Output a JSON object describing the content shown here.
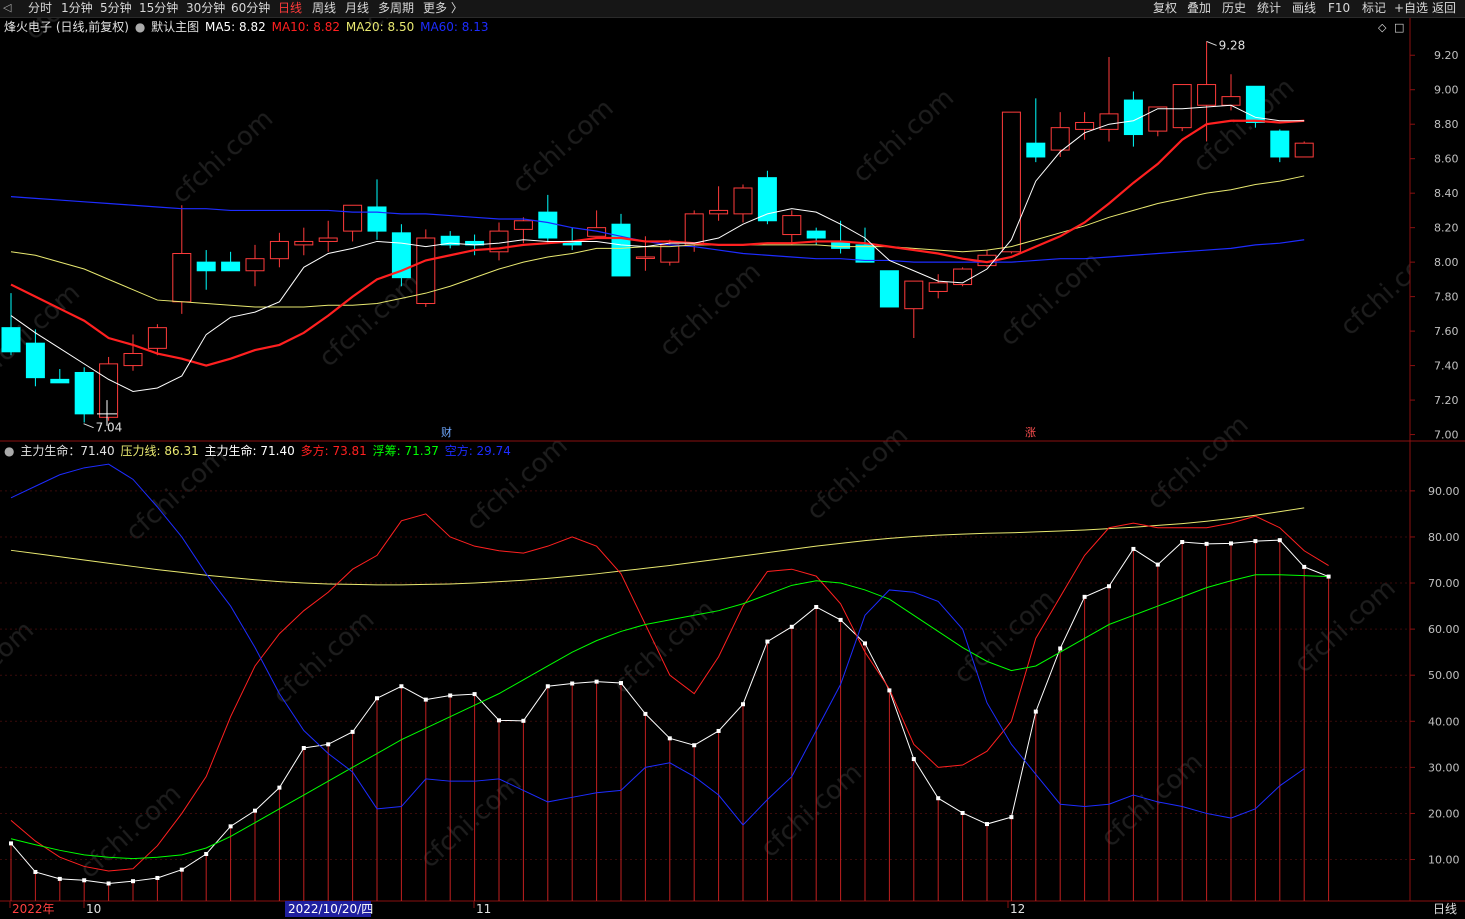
{
  "topbar": {
    "periods": [
      "分时",
      "1分钟",
      "5分钟",
      "15分钟",
      "30分钟",
      "60分钟",
      "日线",
      "周线",
      "月线",
      "多周期",
      "更多 〉"
    ],
    "active_period": "日线",
    "tools": [
      "复权",
      "叠加",
      "历史",
      "统计",
      "画线",
      "F10",
      "标记",
      "+自选",
      "返回"
    ]
  },
  "main_legend": {
    "stock": "烽火电子 (日线,前复权)",
    "indicator_name": "默认主图",
    "ma5": "MA5: 8.82",
    "ma10": "MA10: 8.82",
    "ma20": "MA20: 8.50",
    "ma60": "MA60: 8.13"
  },
  "sub_legend": {
    "title": "主力生命：71.40",
    "pressure": "压力线: 86.31",
    "life": "主力生命: 71.40",
    "long": "多方: 73.81",
    "float": "浮筹: 71.37",
    "short": "空方: 29.74"
  },
  "annotations": {
    "high": "9.28",
    "low": "7.04",
    "cai": "财",
    "zhang": "涨"
  },
  "time_axis": {
    "year": "2022年",
    "oct": "10",
    "cursor_date": "2022/10/20/四",
    "nov": "11",
    "dec": "12"
  },
  "bottom_period": "日线",
  "colors": {
    "up": "#ff3b3b",
    "down": "#00ffff",
    "ma5": "#ffffff",
    "ma10": "#ff2020",
    "ma20": "#e8e870",
    "ma60": "#1d2cff",
    "long": "#ff2020",
    "float": "#00ff00",
    "short": "#1d2cff",
    "pressure": "#e8e870"
  },
  "chart_data": [
    {
      "type": "candlestick",
      "title": "烽火电子 (日线,前复权)",
      "y_ticks": [
        "9.20",
        "9.00",
        "8.80",
        "8.60",
        "8.40",
        "8.20",
        "8.00",
        "7.80",
        "7.60",
        "7.40",
        "7.20",
        "7.00"
      ],
      "ylim": [
        6.98,
        9.3
      ],
      "ohlc": [
        [
          7.62,
          7.82,
          7.46,
          7.48
        ],
        [
          7.53,
          7.61,
          7.28,
          7.33
        ],
        [
          7.32,
          7.38,
          7.3,
          7.3
        ],
        [
          7.36,
          7.39,
          7.07,
          7.12
        ],
        [
          7.1,
          7.45,
          7.08,
          7.41
        ],
        [
          7.4,
          7.58,
          7.37,
          7.47
        ],
        [
          7.5,
          7.64,
          7.46,
          7.62
        ],
        [
          7.77,
          8.33,
          7.7,
          8.05
        ],
        [
          8.0,
          8.07,
          7.84,
          7.95
        ],
        [
          8.0,
          8.06,
          7.95,
          7.95
        ],
        [
          7.95,
          8.1,
          7.86,
          8.02
        ],
        [
          8.02,
          8.17,
          7.97,
          8.12
        ],
        [
          8.1,
          8.2,
          8.04,
          8.12
        ],
        [
          8.12,
          8.24,
          8.06,
          8.14
        ],
        [
          8.18,
          8.33,
          8.12,
          8.33
        ],
        [
          8.32,
          8.48,
          8.13,
          8.18
        ],
        [
          8.17,
          8.22,
          7.86,
          7.91
        ],
        [
          7.76,
          8.19,
          7.74,
          8.14
        ],
        [
          8.15,
          8.18,
          8.08,
          8.1
        ],
        [
          8.12,
          8.16,
          8.04,
          8.1
        ],
        [
          8.06,
          8.23,
          8.01,
          8.18
        ],
        [
          8.19,
          8.26,
          8.11,
          8.24
        ],
        [
          8.29,
          8.39,
          8.11,
          8.14
        ],
        [
          8.12,
          8.2,
          8.07,
          8.1
        ],
        [
          8.15,
          8.3,
          8.15,
          8.2
        ],
        [
          8.22,
          8.28,
          8.1,
          7.92
        ],
        [
          8.03,
          8.15,
          7.95,
          8.03
        ],
        [
          8.0,
          8.13,
          7.98,
          8.1
        ],
        [
          8.1,
          8.3,
          8.06,
          8.28
        ],
        [
          8.28,
          8.44,
          8.24,
          8.3
        ],
        [
          8.28,
          8.45,
          8.23,
          8.43
        ],
        [
          8.49,
          8.53,
          8.22,
          8.24
        ],
        [
          8.16,
          8.3,
          8.1,
          8.27
        ],
        [
          8.18,
          8.2,
          8.1,
          8.14
        ],
        [
          8.12,
          8.24,
          8.05,
          8.08
        ],
        [
          8.1,
          8.2,
          8.0,
          8.0
        ],
        [
          7.95,
          7.95,
          7.74,
          7.74
        ],
        [
          7.73,
          7.89,
          7.56,
          7.89
        ],
        [
          7.83,
          7.93,
          7.79,
          7.88
        ],
        [
          7.87,
          7.97,
          7.86,
          7.96
        ],
        [
          7.98,
          8.07,
          7.97,
          8.04
        ],
        [
          8.06,
          8.87,
          8.05,
          8.87
        ],
        [
          8.69,
          8.95,
          8.58,
          8.61
        ],
        [
          8.65,
          8.87,
          8.61,
          8.78
        ],
        [
          8.77,
          8.87,
          8.71,
          8.81
        ],
        [
          8.77,
          9.19,
          8.7,
          8.86
        ],
        [
          8.94,
          8.99,
          8.67,
          8.74
        ],
        [
          8.76,
          8.9,
          8.73,
          8.9
        ],
        [
          8.78,
          9.03,
          8.76,
          9.03
        ],
        [
          8.91,
          9.28,
          8.7,
          9.03
        ],
        [
          8.91,
          9.09,
          8.88,
          8.96
        ],
        [
          9.02,
          9.02,
          8.78,
          8.81
        ],
        [
          8.76,
          8.77,
          8.58,
          8.61
        ],
        [
          8.61,
          8.7,
          8.61,
          8.69
        ]
      ],
      "ma5": [
        7.69,
        7.59,
        7.5,
        7.41,
        7.32,
        7.25,
        7.27,
        7.34,
        7.58,
        7.68,
        7.71,
        7.77,
        7.97,
        8.05,
        8.08,
        8.12,
        8.11,
        8.09,
        8.11,
        8.1,
        8.11,
        8.13,
        8.12,
        8.12,
        8.12,
        8.1,
        8.09,
        8.11,
        8.11,
        8.14,
        8.22,
        8.28,
        8.31,
        8.29,
        8.22,
        8.14,
        8.01,
        7.95,
        7.89,
        7.88,
        7.96,
        8.13,
        8.47,
        8.64,
        8.75,
        8.8,
        8.82,
        8.89,
        8.89,
        8.9,
        8.91,
        8.84,
        8.82,
        8.82
      ],
      "ma10": [
        7.87,
        7.8,
        7.73,
        7.66,
        7.56,
        7.52,
        7.47,
        7.44,
        7.4,
        7.44,
        7.49,
        7.52,
        7.59,
        7.69,
        7.8,
        7.9,
        7.95,
        8.01,
        8.04,
        8.07,
        8.08,
        8.1,
        8.11,
        8.12,
        8.14,
        8.14,
        8.12,
        8.12,
        8.11,
        8.1,
        8.1,
        8.11,
        8.11,
        8.12,
        8.12,
        8.11,
        8.09,
        8.07,
        8.05,
        8.02,
        8.0,
        8.03,
        8.09,
        8.15,
        8.23,
        8.34,
        8.46,
        8.57,
        8.71,
        8.8,
        8.82,
        8.82,
        8.81,
        8.82
      ],
      "ma20": [
        8.06,
        8.04,
        8.0,
        7.96,
        7.9,
        7.84,
        7.78,
        7.77,
        7.76,
        7.75,
        7.74,
        7.74,
        7.74,
        7.75,
        7.75,
        7.76,
        7.79,
        7.82,
        7.86,
        7.91,
        7.96,
        8.0,
        8.03,
        8.05,
        8.08,
        8.08,
        8.09,
        8.09,
        8.1,
        8.1,
        8.1,
        8.1,
        8.1,
        8.1,
        8.09,
        8.09,
        8.09,
        8.08,
        8.07,
        8.06,
        8.07,
        8.09,
        8.13,
        8.17,
        8.21,
        8.26,
        8.3,
        8.34,
        8.37,
        8.4,
        8.42,
        8.45,
        8.47,
        8.5
      ],
      "ma60": [
        8.38,
        8.37,
        8.36,
        8.35,
        8.34,
        8.33,
        8.32,
        8.31,
        8.31,
        8.3,
        8.3,
        8.3,
        8.3,
        8.3,
        8.29,
        8.29,
        8.28,
        8.28,
        8.27,
        8.26,
        8.25,
        8.25,
        8.23,
        8.2,
        8.18,
        8.15,
        8.12,
        8.1,
        8.09,
        8.07,
        8.05,
        8.04,
        8.03,
        8.02,
        8.02,
        8.01,
        8.01,
        8.0,
        8.0,
        8.0,
        8.0,
        8.0,
        8.01,
        8.02,
        8.02,
        8.03,
        8.04,
        8.05,
        8.06,
        8.07,
        8.08,
        8.1,
        8.11,
        8.13
      ]
    },
    {
      "type": "line",
      "title": "主力生命",
      "y_ticks": [
        "90.00",
        "80.00",
        "70.00",
        "60.00",
        "50.00",
        "40.00",
        "30.00",
        "20.00",
        "10.00"
      ],
      "ylim": [
        1,
        98
      ],
      "series": [
        {
          "name": "压力线",
          "values": [
            77.1,
            76.4,
            75.7,
            75.0,
            74.3,
            73.6,
            72.9,
            72.3,
            71.7,
            71.2,
            70.7,
            70.3,
            70.0,
            69.8,
            69.7,
            69.6,
            69.6,
            69.7,
            69.8,
            70.0,
            70.3,
            70.6,
            71.0,
            71.5,
            72.0,
            72.6,
            73.2,
            73.8,
            74.5,
            75.2,
            75.9,
            76.6,
            77.3,
            78.0,
            78.6,
            79.2,
            79.7,
            80.1,
            80.4,
            80.6,
            80.8,
            80.9,
            81.1,
            81.3,
            81.5,
            81.8,
            82.1,
            82.5,
            82.9,
            83.4,
            84.0,
            84.7,
            85.5,
            86.3
          ]
        },
        {
          "name": "主力生命",
          "values": [
            13.5,
            7.3,
            5.8,
            5.5,
            4.8,
            5.3,
            6.0,
            7.8,
            11.2,
            17.2,
            20.6,
            25.6,
            34.2,
            35.0,
            37.7,
            45.0,
            47.6,
            44.7,
            45.6,
            45.9,
            40.2,
            40.1,
            47.6,
            48.2,
            48.6,
            48.3,
            41.6,
            36.3,
            34.8,
            37.9,
            43.7,
            57.3,
            60.5,
            64.8,
            62.0,
            56.9,
            46.7,
            31.8,
            23.3,
            20.1,
            17.7,
            19.2,
            42.1,
            55.8,
            67.0,
            69.3,
            77.4,
            74.0,
            78.9,
            78.5,
            78.6,
            79.1,
            79.3,
            73.5,
            71.4
          ]
        },
        {
          "name": "多方",
          "values": [
            18.5,
            14.0,
            10.5,
            8.5,
            7.5,
            8.0,
            13.0,
            20.0,
            28.0,
            41.0,
            52.0,
            59.0,
            64.0,
            68.0,
            73.0,
            76.0,
            83.5,
            85.0,
            80.0,
            78.0,
            77.0,
            76.5,
            78.0,
            80.0,
            78.0,
            72.0,
            61.0,
            50.0,
            46.0,
            54.0,
            65.0,
            72.5,
            73.0,
            71.5,
            65.5,
            55.0,
            47.0,
            35.0,
            30.0,
            30.5,
            33.5,
            40.0,
            58.0,
            67.0,
            76.0,
            82.0,
            83.0,
            82.0,
            82.0,
            82.0,
            83.0,
            84.5,
            82.0,
            77.0,
            73.8
          ]
        },
        {
          "name": "浮筹",
          "values": [
            14.5,
            13.2,
            12.0,
            11.0,
            10.5,
            10.2,
            10.5,
            11.0,
            12.5,
            15.0,
            18.0,
            21.0,
            24.0,
            27.0,
            30.0,
            33.0,
            36.0,
            38.5,
            41.0,
            43.5,
            46.0,
            49.0,
            52.0,
            55.0,
            57.5,
            59.5,
            61.0,
            62.0,
            63.0,
            64.0,
            65.5,
            67.5,
            69.5,
            70.5,
            70.0,
            68.5,
            66.5,
            63.0,
            59.5,
            56.0,
            53.0,
            51.0,
            52.0,
            55.0,
            58.0,
            61.0,
            63.0,
            65.0,
            67.0,
            69.0,
            70.5,
            71.8,
            71.8,
            71.6,
            71.4
          ]
        },
        {
          "name": "空方",
          "values": [
            88.5,
            91.0,
            93.5,
            95.0,
            95.8,
            92.5,
            86.5,
            80.0,
            72.0,
            65.0,
            56.0,
            46.0,
            38.0,
            33.0,
            29.0,
            21.0,
            21.5,
            27.5,
            27.0,
            27.0,
            27.5,
            25.0,
            22.5,
            23.5,
            24.5,
            25.0,
            30.0,
            31.0,
            28.0,
            24.0,
            17.5,
            23.0,
            28.0,
            38.0,
            48.0,
            63.0,
            68.5,
            68.0,
            66.0,
            60.0,
            44.0,
            35.0,
            28.5,
            22.0,
            21.5,
            22.0,
            24.0,
            22.5,
            21.5,
            20.0,
            19.0,
            21.0,
            26.0,
            29.7
          ]
        }
      ],
      "bars": "主力生命"
    }
  ]
}
